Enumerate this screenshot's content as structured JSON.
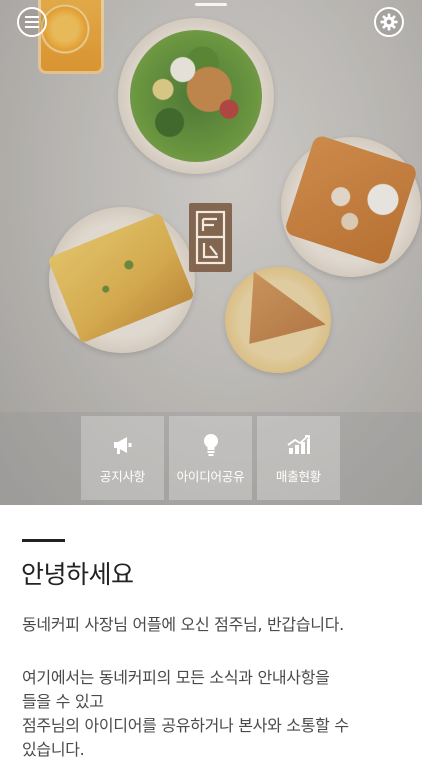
{
  "quick_menu": [
    {
      "label": "공지사항",
      "icon": "megaphone-icon"
    },
    {
      "label": "아이디어공유",
      "icon": "lightbulb-icon"
    },
    {
      "label": "매출현황",
      "icon": "sales-chart-icon"
    }
  ],
  "content": {
    "title": "안녕하세요",
    "paragraph1": "동네커피 사장님 어플에 오신 점주님, 반갑습니다.",
    "paragraph2_line1": "여기에서는 동네커피의 모든 소식과 안내사항을",
    "paragraph2_line2": "들을 수 있고",
    "paragraph2_line3": "점주님의 아이디어를 공유하거나 본사와 소통할 수",
    "paragraph2_line4": "있습니다."
  },
  "colors": {
    "accent_text": "#222222",
    "body_text": "#4a4a4a",
    "logo_brown": "#78563e"
  }
}
